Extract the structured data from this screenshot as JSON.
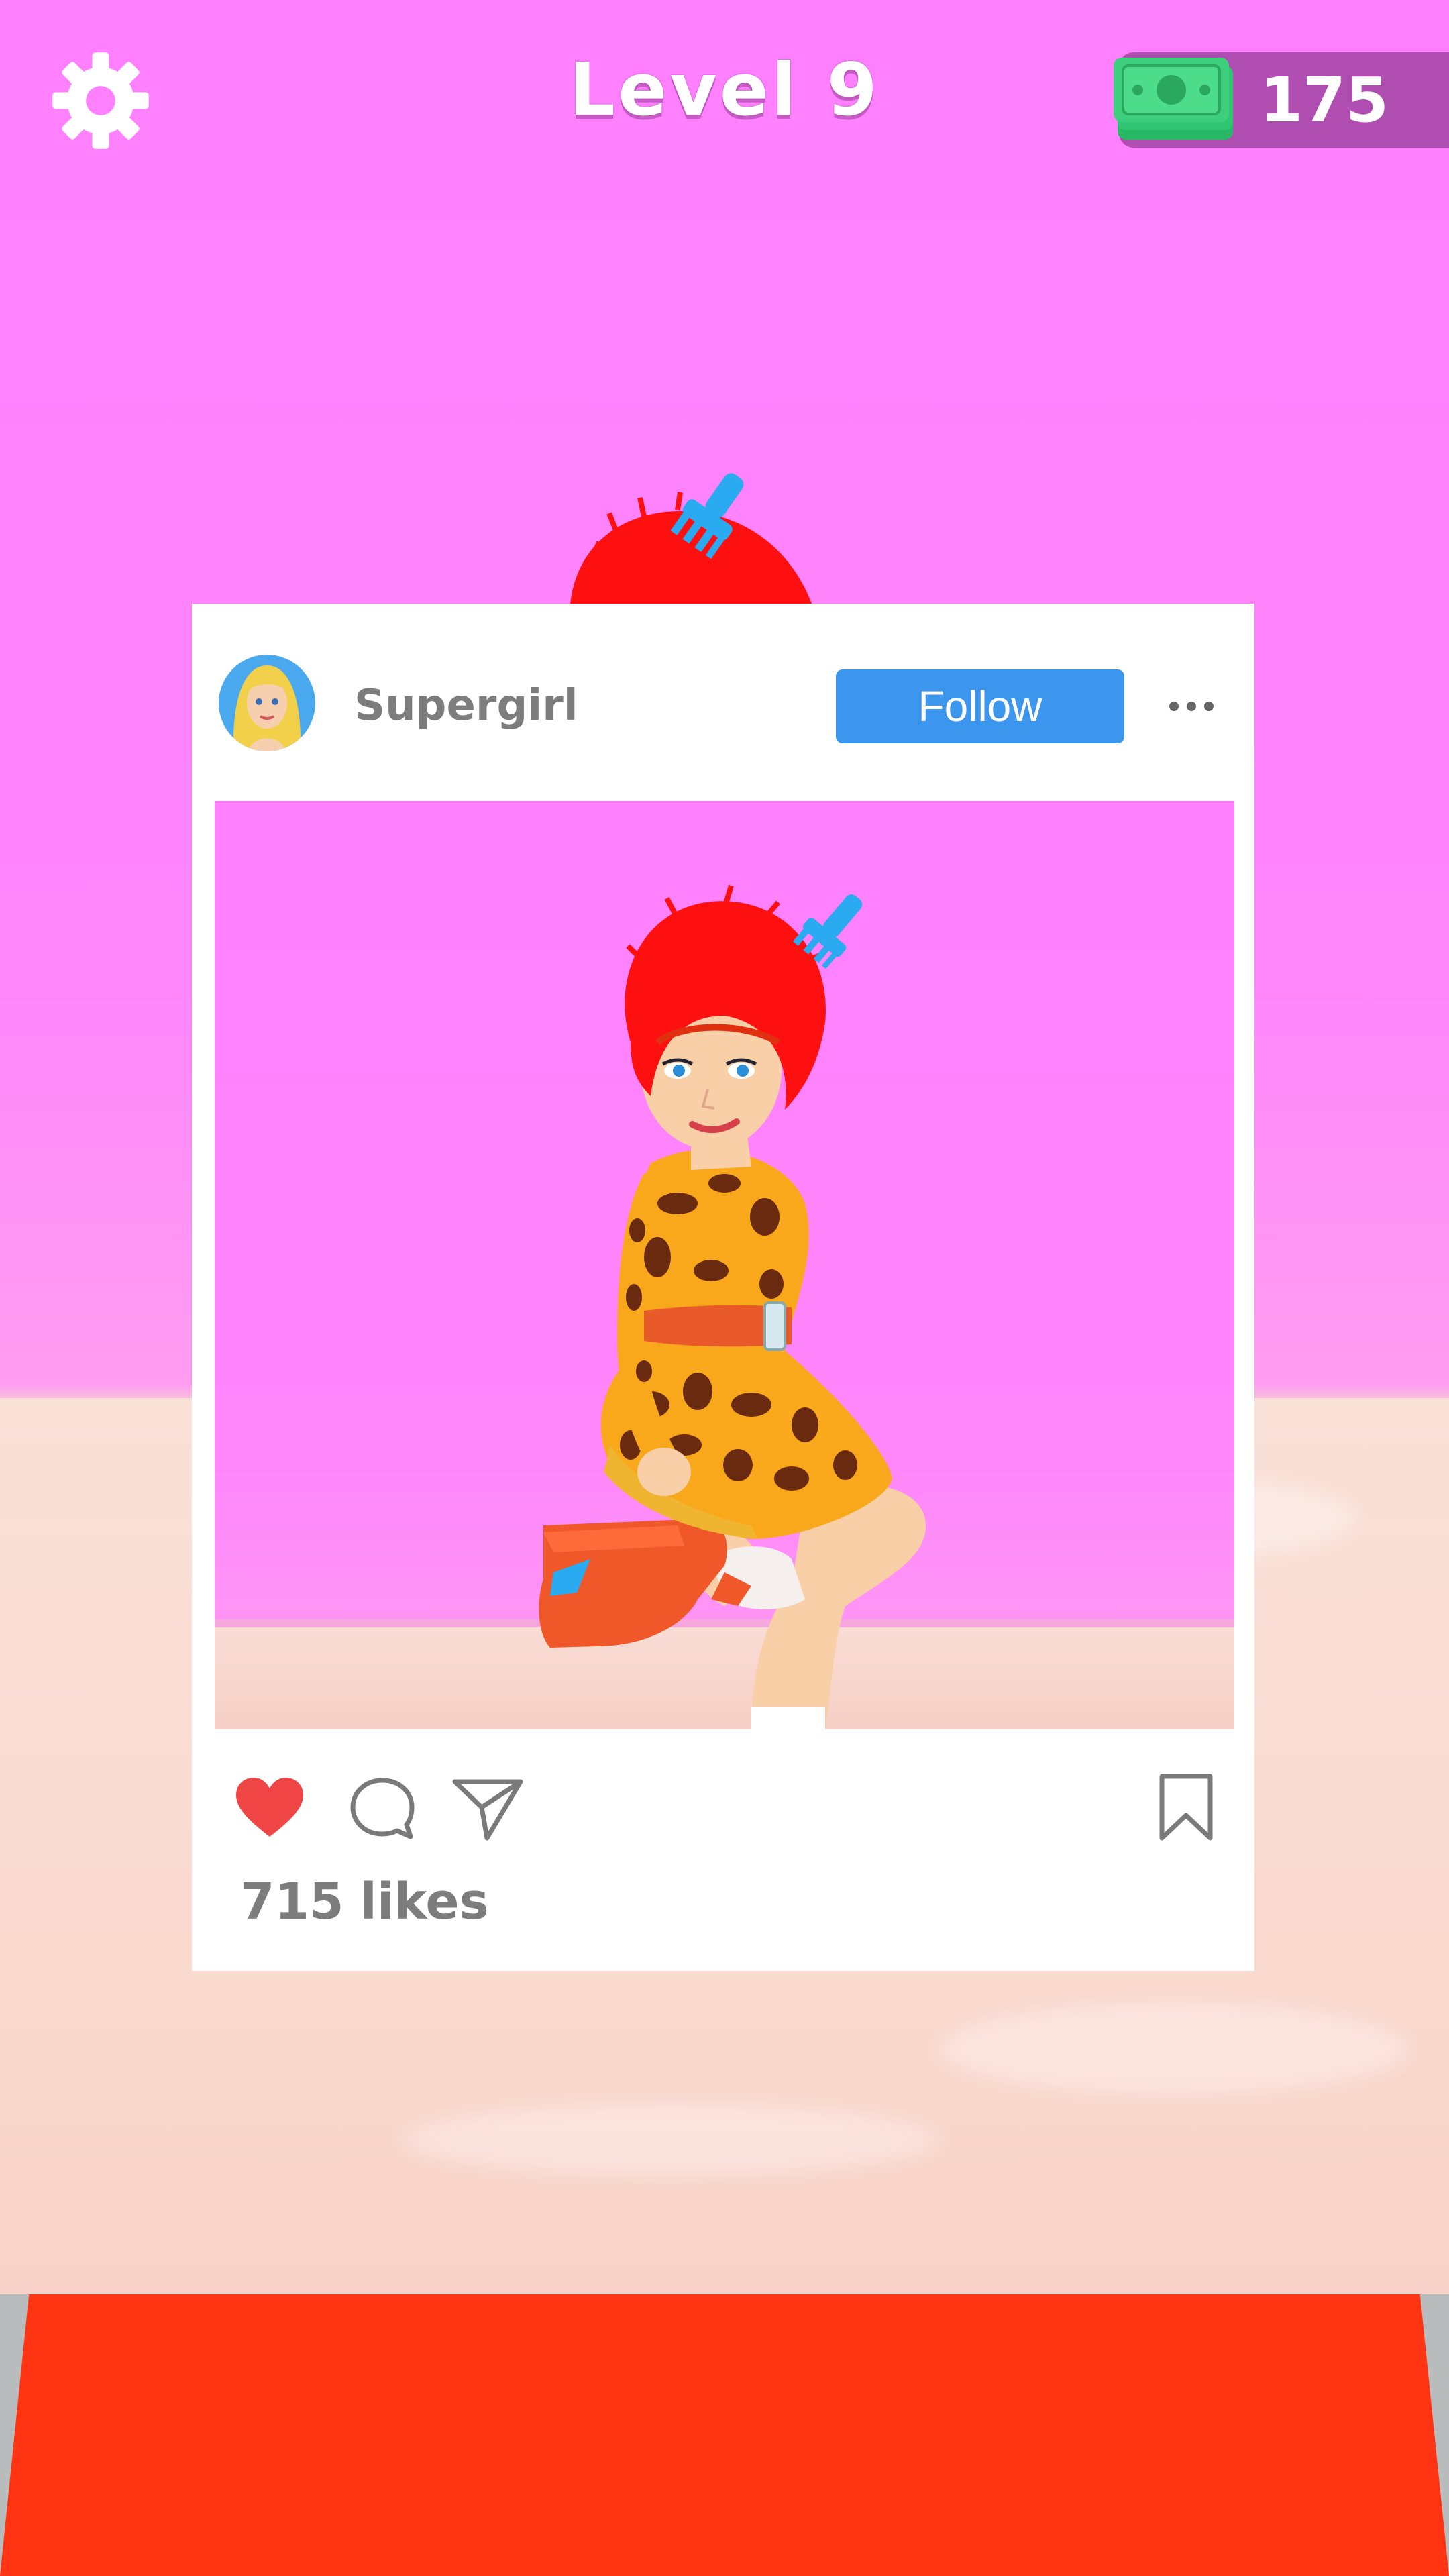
{
  "hud": {
    "level_label": "Level 9",
    "cash_amount": "175",
    "settings_icon": "gear-icon",
    "cash_icon": "banknote-icon"
  },
  "post": {
    "username": "Supergirl",
    "follow_label": "Follow",
    "more_icon": "ellipsis-icon",
    "likes_count": "715",
    "likes_label": "likes",
    "actions": [
      "heart-icon",
      "comment-icon",
      "share-icon",
      "bookmark-icon"
    ]
  },
  "colors": {
    "backdrop": "#ff80ff",
    "follow_button": "#3c96ee",
    "heart": "#f04545",
    "runway": "#ff3412",
    "cash_panel": "#963c96",
    "banknote": "#3ecf7c",
    "hair": "#ff1010",
    "comb": "#2aaaf0"
  }
}
